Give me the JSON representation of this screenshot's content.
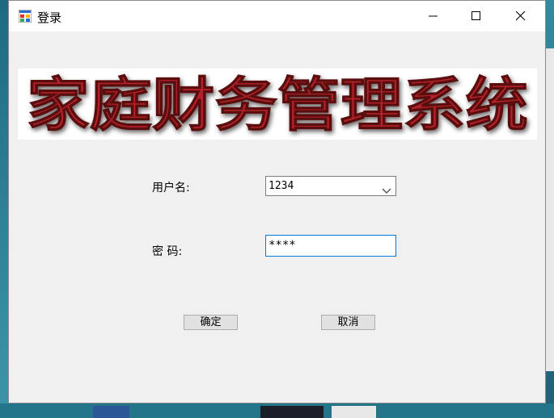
{
  "window": {
    "title": "登录",
    "icon": "app-window-icon",
    "controls": [
      "minimize-icon",
      "maximize-icon",
      "close-icon"
    ]
  },
  "banner": {
    "text": "家庭财务管理系统",
    "text_color": "#b3222a"
  },
  "form": {
    "username_label": "用户名:",
    "username_value": "1234",
    "password_label": "密 码:",
    "password_value": "****"
  },
  "buttons": {
    "ok_label": "确定",
    "cancel_label": "取消"
  }
}
